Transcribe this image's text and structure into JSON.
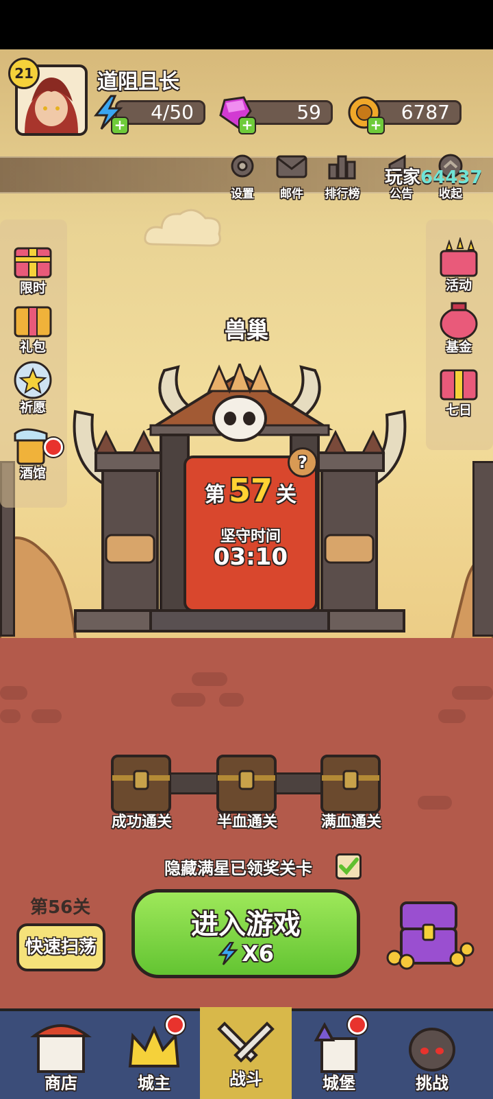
{
  "player": {
    "level": "21",
    "name": "道阻且长",
    "id_prefix": "玩家",
    "id_number": "64437"
  },
  "resources": {
    "energy": "4/50",
    "gems": "59",
    "coins": "6787"
  },
  "top_menu": [
    {
      "label": "设置",
      "icon": "gear-icon"
    },
    {
      "label": "邮件",
      "icon": "mail-icon"
    },
    {
      "label": "排行榜",
      "icon": "ranking-icon"
    },
    {
      "label": "公告",
      "icon": "announcement-icon"
    },
    {
      "label": "收起",
      "icon": "collapse-icon"
    }
  ],
  "left_menu": [
    {
      "label": "限时",
      "icon": "gift-box-icon"
    },
    {
      "label": "礼包",
      "icon": "gift-pack-icon"
    },
    {
      "label": "祈愿",
      "icon": "wish-star-icon"
    },
    {
      "label": "酒馆",
      "icon": "beer-mug-icon",
      "badge": true
    }
  ],
  "right_menu": [
    {
      "label": "活动",
      "icon": "event-gift-icon"
    },
    {
      "label": "基金",
      "icon": "fund-bag-icon"
    },
    {
      "label": "七日",
      "icon": "seven-day-gift-icon"
    }
  ],
  "stage": {
    "name": "兽巢",
    "level_prefix": "第",
    "level_number": "57",
    "level_suffix": "关",
    "defend_label": "坚守时间",
    "defend_time": "03:10",
    "help": "?"
  },
  "rewards": [
    {
      "label": "成功通关"
    },
    {
      "label": "半血通关"
    },
    {
      "label": "满血通关"
    }
  ],
  "hide_completed": {
    "label": "隐藏满星已领奖关卡",
    "checked": true
  },
  "sweep": {
    "level_label": "第56关",
    "button": "快速扫荡"
  },
  "enter": {
    "button": "进入游戏",
    "cost": "X6"
  },
  "bottom_nav": [
    {
      "label": "商店",
      "icon": "shop-icon",
      "active": false,
      "badge": false
    },
    {
      "label": "城主",
      "icon": "crown-icon",
      "active": false,
      "badge": true
    },
    {
      "label": "战斗",
      "icon": "crossed-swords-icon",
      "active": true,
      "badge": false
    },
    {
      "label": "城堡",
      "icon": "castle-icon",
      "active": false,
      "badge": true
    },
    {
      "label": "挑战",
      "icon": "demon-helmet-icon",
      "active": false,
      "badge": false
    }
  ],
  "colors": {
    "accent_green": "#6fcb3a",
    "banner_red": "#d9472d",
    "level_yellow": "#ffd233",
    "nav_bg": "#3b4d79",
    "player_id": "#6fe3d6"
  }
}
